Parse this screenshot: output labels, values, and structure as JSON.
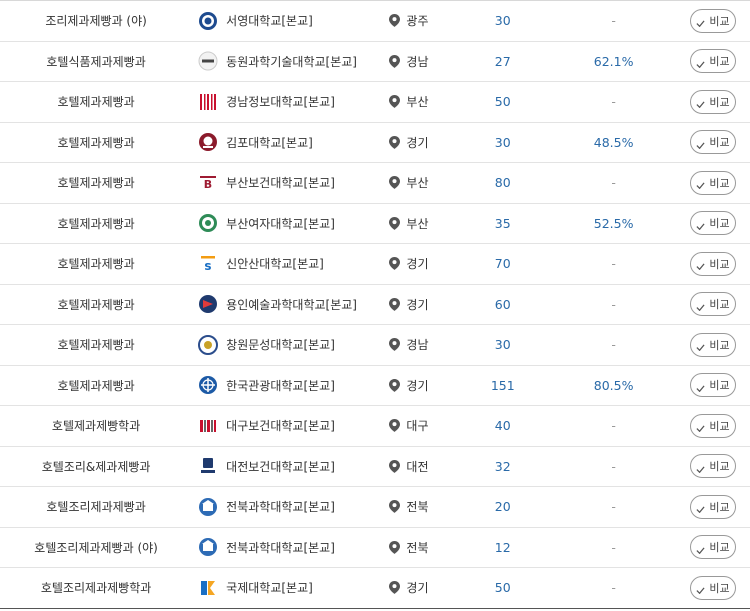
{
  "rows": [
    {
      "dept": "조리제과제빵과 (야)",
      "school": "서영대학교[본교]",
      "logo": "seoyoung-logo",
      "region": "광주",
      "quota": "30",
      "rate": "-"
    },
    {
      "dept": "호텔식품제과제빵과",
      "school": "동원과학기술대학교[본교]",
      "logo": "dongwon-logo",
      "region": "경남",
      "quota": "27",
      "rate": "62.1%"
    },
    {
      "dept": "호텔제과제빵과",
      "school": "경남정보대학교[본교]",
      "logo": "kyungnam-info-logo",
      "region": "부산",
      "quota": "50",
      "rate": "-"
    },
    {
      "dept": "호텔제과제빵과",
      "school": "김포대학교[본교]",
      "logo": "kimpo-logo",
      "region": "경기",
      "quota": "30",
      "rate": "48.5%"
    },
    {
      "dept": "호텔제과제빵과",
      "school": "부산보건대학교[본교]",
      "logo": "bhu-logo",
      "region": "부산",
      "quota": "80",
      "rate": "-"
    },
    {
      "dept": "호텔제과제빵과",
      "school": "부산여자대학교[본교]",
      "logo": "busan-women-logo",
      "region": "부산",
      "quota": "35",
      "rate": "52.5%"
    },
    {
      "dept": "호텔제과제빵과",
      "school": "신안산대학교[본교]",
      "logo": "sau-logo",
      "region": "경기",
      "quota": "70",
      "rate": "-"
    },
    {
      "dept": "호텔제과제빵과",
      "school": "용인예술과학대학교[본교]",
      "logo": "yongin-logo",
      "region": "경기",
      "quota": "60",
      "rate": "-"
    },
    {
      "dept": "호텔제과제빵과",
      "school": "창원문성대학교[본교]",
      "logo": "changwon-logo",
      "region": "경남",
      "quota": "30",
      "rate": "-"
    },
    {
      "dept": "호텔제과제빵과",
      "school": "한국관광대학교[본교]",
      "logo": "tourism-logo",
      "region": "경기",
      "quota": "151",
      "rate": "80.5%"
    },
    {
      "dept": "호텔제과제빵학과",
      "school": "대구보건대학교[본교]",
      "logo": "daegu-health-logo",
      "region": "대구",
      "quota": "40",
      "rate": "-"
    },
    {
      "dept": "호텔조리&제과제빵과",
      "school": "대전보건대학교[본교]",
      "logo": "daejeon-health-logo",
      "region": "대전",
      "quota": "32",
      "rate": "-"
    },
    {
      "dept": "호텔조리제과제빵과",
      "school": "전북과학대학교[본교]",
      "logo": "jeonbuk-logo",
      "region": "전북",
      "quota": "20",
      "rate": "-"
    },
    {
      "dept": "호텔조리제과제빵과 (야)",
      "school": "전북과학대학교[본교]",
      "logo": "jeonbuk-logo",
      "region": "전북",
      "quota": "12",
      "rate": "-"
    },
    {
      "dept": "호텔조리제과제빵학과",
      "school": "국제대학교[본교]",
      "logo": "kookje-logo",
      "region": "경기",
      "quota": "50",
      "rate": "-"
    }
  ],
  "compare_label": "비교",
  "icons": {
    "region": "map-pin-icon",
    "compare": "check-icon"
  },
  "colors": {
    "value_blue": "#2a6aa8",
    "dash_gray": "#999999",
    "border": "#e3e3e3"
  }
}
